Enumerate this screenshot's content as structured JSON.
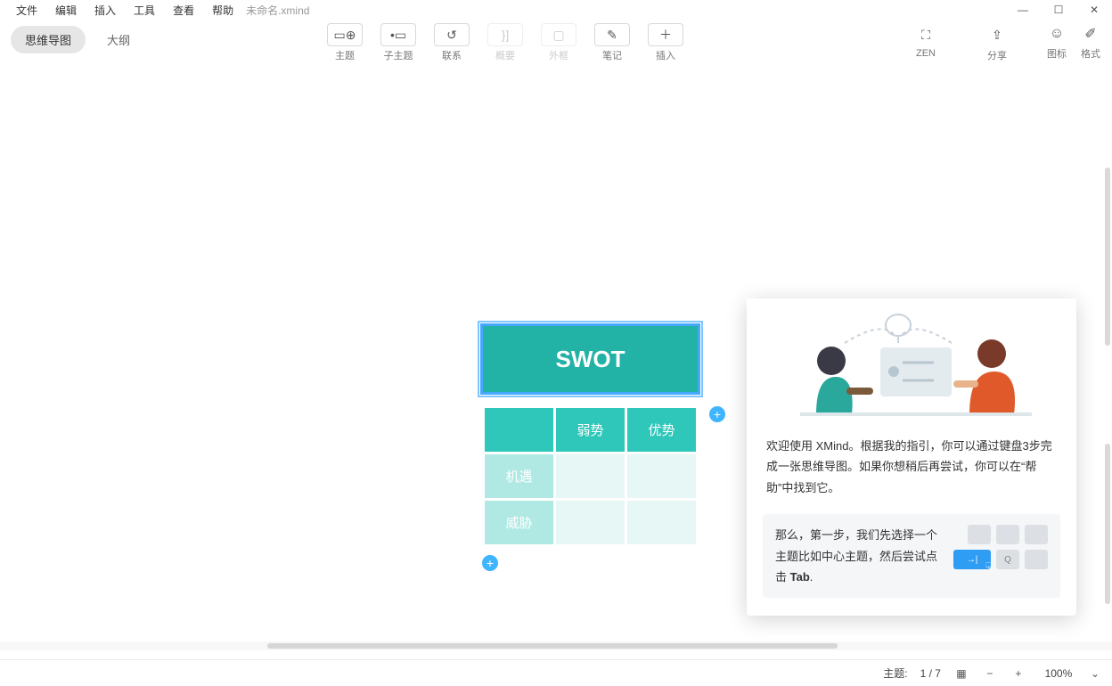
{
  "menu": {
    "file": "文件",
    "edit": "编辑",
    "insert": "插入",
    "tools": "工具",
    "view": "查看",
    "help": "帮助"
  },
  "filename": "未命名.xmind",
  "viewtabs": {
    "mindmap": "思维导图",
    "outline": "大纲"
  },
  "toolbar": {
    "topic": "主题",
    "subtopic": "子主题",
    "relation": "联系",
    "summary": "概要",
    "boundary": "外框",
    "note": "笔记",
    "insert": "插入",
    "zen": "ZEN",
    "share": "分享",
    "sticker": "图标",
    "format": "格式"
  },
  "mindmap": {
    "title": "SWOT",
    "cols": [
      "弱势",
      "优势"
    ],
    "rows": [
      "机遇",
      "威胁"
    ]
  },
  "popup": {
    "text1": "欢迎使用 XMind。根据我的指引，你可以通过键盘3步完成一张思维导图。如果你想稍后再尝试，你可以在“帮助”中找到它。",
    "tip_pre": "那么，第一步，我们先选择一个主题比如中心主题，然后尝试点击 ",
    "tip_bold": "Tab",
    "tip_post": ".",
    "tab_key": "→|",
    "q_key": "Q"
  },
  "status": {
    "topics_label": "主题:",
    "topics_value": "1 / 7",
    "zoom": "100%"
  }
}
